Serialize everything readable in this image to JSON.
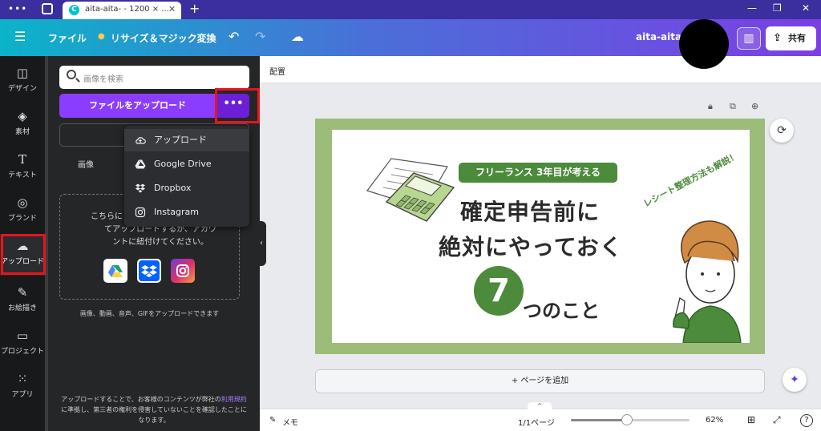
{
  "browser": {
    "menu_dots": "•••",
    "tab_title": "aita-aita- - 1200 × ...",
    "tab_favicon": "C",
    "close": "✕",
    "new_tab": "+",
    "window_controls": [
      "—",
      "❐",
      "✕"
    ]
  },
  "header": {
    "menu_icon": "☰",
    "file_label": "ファイル",
    "resize_label": "リサイズ＆マジック変換",
    "resize_icon": "●",
    "undo": "↶",
    "redo": "↷",
    "cloud": "☁",
    "user_name": "aita-aita-",
    "insights": "▥",
    "share_label": "共有",
    "share_icon": "⇪"
  },
  "rail": [
    {
      "label": "デザイン",
      "icon": "◫"
    },
    {
      "label": "素材",
      "icon": "◈"
    },
    {
      "label": "テキスト",
      "icon": "T"
    },
    {
      "label": "ブランド",
      "icon": "◎"
    },
    {
      "label": "アップロード",
      "icon": "☁"
    },
    {
      "label": "お絵描き",
      "icon": "✎"
    },
    {
      "label": "プロジェクト",
      "icon": "▭"
    },
    {
      "label": "アプリ",
      "icon": "⁙"
    }
  ],
  "panel": {
    "search_placeholder": "画像を検索",
    "upload_button": "ファイルをアップロード",
    "more_button": "•••",
    "tab_images": "画像",
    "dropzone_line1": "こちらに",
    "dropzone_line2": "てアップロードするか、アカウ",
    "dropzone_line3": "ントに紐付けてください。",
    "formats": "画像、動画、音声、GIFをアップロードできます",
    "terms_before": "アップロードすることで、お客様のコンテンツが弊社の",
    "terms_link": "利用規約",
    "terms_after": "に準拠し、第三者の権利を侵害していないことを確認したことになります。"
  },
  "menu": [
    {
      "label": "アップロード",
      "icon": "upload-cloud-icon"
    },
    {
      "label": "Google Drive",
      "icon": "google-drive-icon"
    },
    {
      "label": "Dropbox",
      "icon": "dropbox-icon"
    },
    {
      "label": "Instagram",
      "icon": "instagram-icon"
    }
  ],
  "canvas": {
    "arrange_label": "配置",
    "add_page": "+ ページを追加",
    "badge": "フリーランス 3年目が考える",
    "headline1": "確定申告前に",
    "headline2": "絶対にやっておく",
    "big_number": "7",
    "suffix": "つのこと",
    "side_note": "レシート整理方法も解説！"
  },
  "footer": {
    "notes": "メモ",
    "page_indicator": "1/1ページ",
    "zoom": "62%",
    "zoom_fraction": 0.47
  },
  "colors": {
    "accent": "#8b3dff",
    "green": "#4c8a3c",
    "frame_green": "#9bbd79",
    "highlight_red": "#e8141c"
  }
}
